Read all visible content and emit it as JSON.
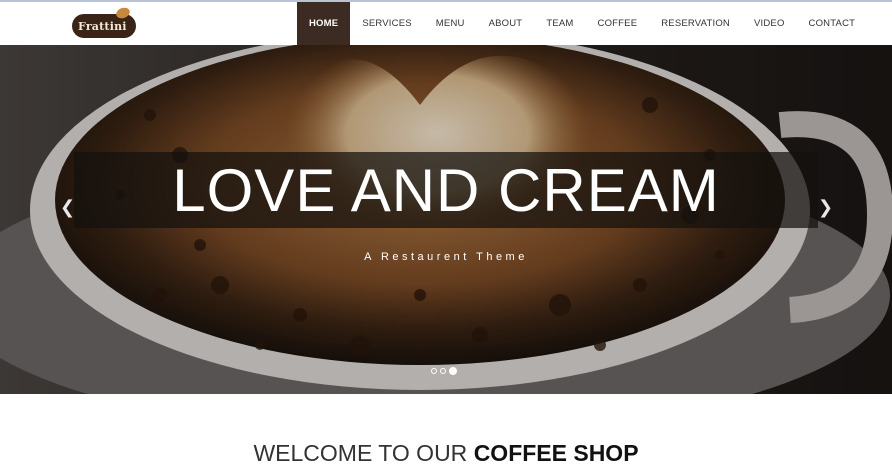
{
  "brand": {
    "logo_text": "Frattini"
  },
  "nav": {
    "items": [
      {
        "label": "HOME",
        "active": true
      },
      {
        "label": "SERVICES"
      },
      {
        "label": "MENU"
      },
      {
        "label": "ABOUT"
      },
      {
        "label": "TEAM"
      },
      {
        "label": "COFFEE"
      },
      {
        "label": "RESERVATION"
      },
      {
        "label": "VIDEO"
      },
      {
        "label": "CONTACT"
      }
    ]
  },
  "hero": {
    "title": "LOVE AND CREAM",
    "subtitle": "A Restaurent Theme",
    "prev_icon": "chevron-left-icon",
    "next_icon": "chevron-right-icon",
    "slides_count": 3,
    "active_slide": 3
  },
  "welcome": {
    "prefix": "WELCOME TO OUR",
    "strong": "COFFEE SHOP"
  },
  "colors": {
    "nav_active_bg": "#3b2b22",
    "band_bg": "#14100e"
  }
}
